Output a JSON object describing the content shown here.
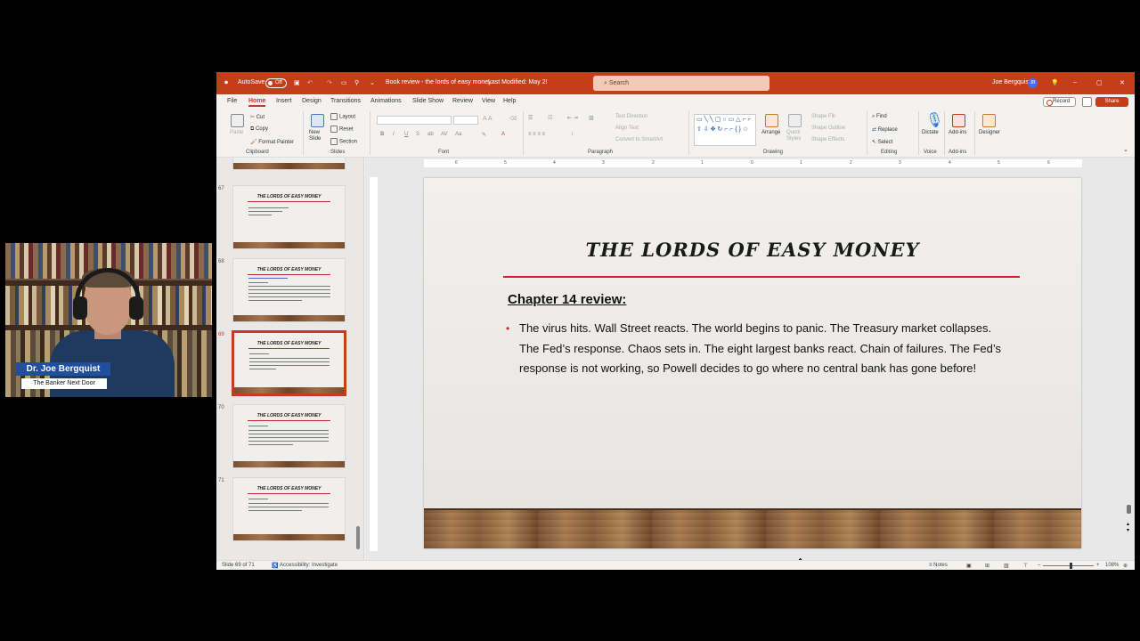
{
  "titlebar": {
    "autosave_label": "AutoSave",
    "autosave_state": "Off",
    "document_title": "Book review - the lords of easy money",
    "last_modified": "Last Modified: May 2!",
    "search_placeholder": "Search",
    "user_name": "Joe Bergquist",
    "user_initials": "JB",
    "accent_color": "#c43e1c"
  },
  "menu": {
    "tabs": [
      "File",
      "Home",
      "Insert",
      "Design",
      "Transitions",
      "Animations",
      "Slide Show",
      "Review",
      "View",
      "Help"
    ],
    "active_tab": "Home",
    "record_label": "Record",
    "share_label": "Share"
  },
  "ribbon": {
    "clipboard": {
      "paste": "Paste",
      "cut": "Cut",
      "copy": "Copy",
      "format_painter": "Format Painter",
      "label": "Clipboard"
    },
    "slides": {
      "new_slide": "New Slide",
      "layout": "Layout",
      "reset": "Reset",
      "section": "Section",
      "label": "Slides"
    },
    "font": {
      "label": "Font"
    },
    "paragraph": {
      "text_direction": "Text Direction",
      "align_text": "Align Text",
      "convert_smartart": "Convert to SmartArt",
      "label": "Paragraph"
    },
    "drawing": {
      "arrange": "Arrange",
      "quick_styles": "Quick Styles",
      "shape_fill": "Shape Fill",
      "shape_outline": "Shape Outline",
      "shape_effects": "Shape Effects",
      "label": "Drawing"
    },
    "editing": {
      "find": "Find",
      "replace": "Replace",
      "select": "Select",
      "label": "Editing"
    },
    "voice": {
      "dictate": "Dictate",
      "label": "Voice"
    },
    "addins": {
      "addins": "Add-ins",
      "label": "Add-ins"
    },
    "designer": {
      "designer": "Designer"
    }
  },
  "ruler": {
    "ticks": [
      "6",
      "5",
      "4",
      "3",
      "2",
      "1",
      "0",
      "1",
      "2",
      "3",
      "4",
      "5",
      "6"
    ]
  },
  "thumbnails": [
    {
      "number": "67",
      "title": "THE LORDS OF EASY MONEY",
      "selected": false
    },
    {
      "number": "68",
      "title": "THE LORDS OF EASY MONEY",
      "selected": false
    },
    {
      "number": "69",
      "title": "THE LORDS OF EASY MONEY",
      "selected": true
    },
    {
      "number": "70",
      "title": "THE LORDS OF EASY MONEY",
      "selected": false
    },
    {
      "number": "71",
      "title": "THE LORDS OF EASY MONEY",
      "selected": false
    }
  ],
  "slide": {
    "title": "THE LORDS OF EASY MONEY",
    "heading": "Chapter 14 review:",
    "bullet": "The virus hits. Wall Street reacts. The world begins to panic. The Treasury market collapses. The Fed’s response. Chaos sets in.  The eight largest banks react. Chain of failures. The Fed’s response is not working, so Powell decides to go where no central bank has gone before!"
  },
  "status": {
    "slide_indicator": "Slide 69 of 71",
    "accessibility": "Accessibility: Investigate",
    "notes": "Notes",
    "zoom": "108%"
  },
  "webcam": {
    "name": "Dr. Joe Bergquist",
    "subtitle": "The Banker Next Door"
  }
}
